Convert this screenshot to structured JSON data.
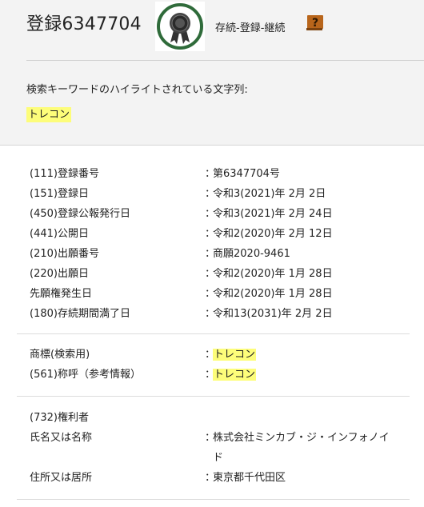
{
  "header": {
    "registration_title": "登録6347704",
    "status_text": "存続-登録-継続",
    "help_glyph": "?",
    "keyword_label": "検索キーワードのハイライトされている文字列:",
    "keyword": "トレコン"
  },
  "section1": [
    {
      "label": "(111)登録番号",
      "value": "第6347704号"
    },
    {
      "label": "(151)登録日",
      "value": "令和3(2021)年 2月 2日"
    },
    {
      "label": "(450)登録公報発行日",
      "value": "令和3(2021)年 2月 24日"
    },
    {
      "label": "(441)公開日",
      "value": "令和2(2020)年 2月 12日"
    },
    {
      "label": "(210)出願番号",
      "value": "商願2020-9461"
    },
    {
      "label": "(220)出願日",
      "value": "令和2(2020)年 1月 28日"
    },
    {
      "label": "先願権発生日",
      "value": "令和2(2020)年 1月 28日"
    },
    {
      "label": "(180)存続期間満了日",
      "value": "令和13(2031)年 2月 2日"
    }
  ],
  "section2": [
    {
      "label": "商標(検索用)",
      "value": "トレコン"
    },
    {
      "label": "(561)称呼（参考情報）",
      "value": "トレコン"
    }
  ],
  "section3": {
    "heading": "(732)権利者",
    "name_label": "氏名又は名称",
    "name_value": "株式会社ミンカブ・ジ・インフォノイド",
    "address_label": "住所又は居所",
    "address_value": "東京都千代田区"
  },
  "colon": "：",
  "colors": {
    "highlight": "#fdfd7a",
    "badge_green": "#2f6b3a",
    "help_orange": "#b8651b",
    "header_bg": "#f3f3f3"
  }
}
